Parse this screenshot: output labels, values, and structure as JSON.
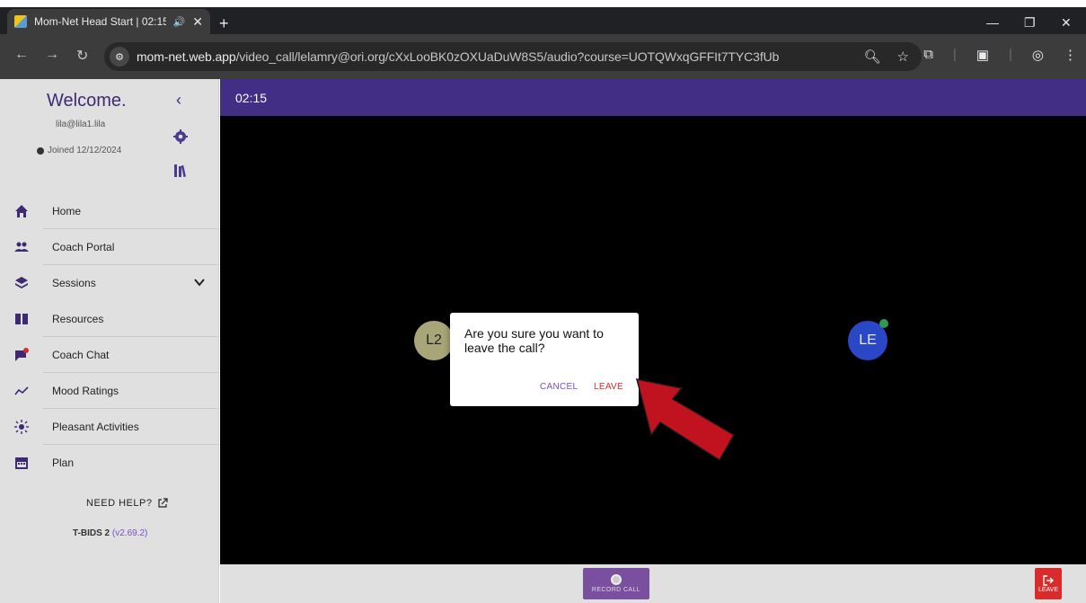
{
  "browser": {
    "tab_title": "Mom-Net Head Start | 02:15",
    "tab_audio": "🔊",
    "tab_close": "✕",
    "new_tab": "+",
    "url_host": "mom-net.web.app",
    "url_path": "/video_call/lelamry@ori.org/cXxLooBK0zOXUaDuW8S5/audio?course=UOTQWxqGFFIt7TYC3fUb"
  },
  "sidebar": {
    "welcome": "Welcome.",
    "email": "lila@lila1.lila",
    "joined": "Joined 12/12/2024",
    "menu": [
      {
        "label": "Home",
        "icon": "home-icon"
      },
      {
        "label": "Coach Portal",
        "icon": "people-icon"
      },
      {
        "label": "Sessions",
        "icon": "layers-icon"
      },
      {
        "label": "Resources",
        "icon": "book-icon"
      },
      {
        "label": "Coach Chat",
        "icon": "chat-icon"
      },
      {
        "label": "Mood Ratings",
        "icon": "trend-icon"
      },
      {
        "label": "Pleasant Activities",
        "icon": "sun-icon"
      },
      {
        "label": "Plan",
        "icon": "calendar-icon"
      }
    ],
    "need_help": "NEED HELP?",
    "version_name": "T-BIDS 2",
    "version_number": "(v2.69.2)"
  },
  "call": {
    "timer": "02:15",
    "participants": [
      {
        "initials": "L2",
        "color": "#a8a679"
      },
      {
        "initials": "LE",
        "color": "#2a47c8",
        "online": true
      }
    ],
    "record_label": "RECORD CALL",
    "leave_label": "LEAVE"
  },
  "dialog": {
    "message": "Are you sure you want to leave the call?",
    "cancel": "CANCEL",
    "leave": "LEAVE"
  },
  "colors": {
    "brand": "#422e85",
    "accent": "#7a4fc7",
    "danger": "#d92b2b",
    "arrow": "#c1121f"
  }
}
